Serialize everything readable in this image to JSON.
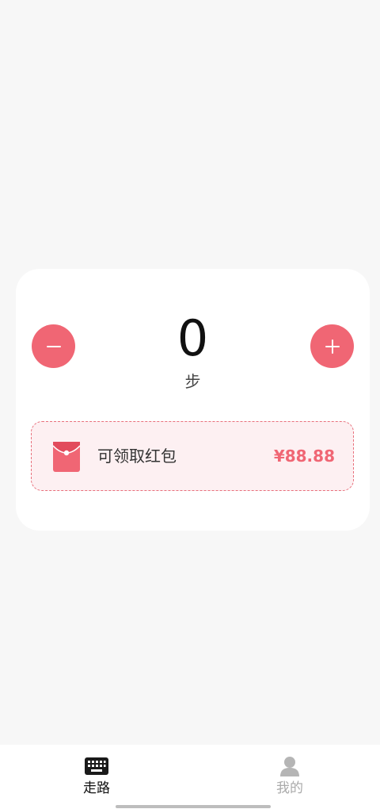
{
  "counter": {
    "value": "0",
    "unit": "步",
    "minus_icon": "minus-icon",
    "plus_icon": "plus-icon"
  },
  "redpacket": {
    "label": "可领取红包",
    "amount": "¥88.88",
    "icon": "red-envelope-icon"
  },
  "tabs": [
    {
      "label": "走路",
      "icon": "keyboard-icon",
      "active": true
    },
    {
      "label": "我的",
      "icon": "person-icon",
      "active": false
    }
  ],
  "colors": {
    "accent": "#f06674",
    "background": "#f7f7f7",
    "card": "#ffffff",
    "redpacket_bg": "#fdf0f2"
  }
}
